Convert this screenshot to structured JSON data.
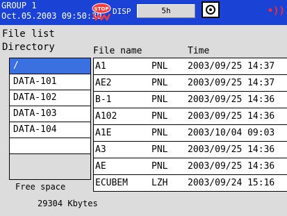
{
  "header": {
    "group": "GROUP 1",
    "datetime": "Oct.05.2003 09:50:30",
    "disp_label": "DISP",
    "disp_value": "5h",
    "stop_icon": "stop-recording-icon",
    "record_icon": "record-target-icon",
    "alarm_icon": "alarm-indicator-icon",
    "colors": {
      "header_bg": "#1a43d6",
      "alarm": "#ff2a2a",
      "selection": "#3b70e0"
    }
  },
  "page": {
    "title": "File list",
    "directory_label": "Directory",
    "filename_header": "File name",
    "time_header": "Time"
  },
  "directories": [
    {
      "name": "/",
      "selected": true
    },
    {
      "name": "DATA-101",
      "selected": false
    },
    {
      "name": "DATA-102",
      "selected": false
    },
    {
      "name": "DATA-103",
      "selected": false
    },
    {
      "name": "DATA-104",
      "selected": false
    },
    {
      "name": "",
      "selected": false
    }
  ],
  "files": [
    {
      "name": "A1",
      "type": "PNL",
      "time": "2003/09/25 14:37"
    },
    {
      "name": "AE2",
      "type": "PNL",
      "time": "2003/09/25 14:37"
    },
    {
      "name": "B-1",
      "type": "PNL",
      "time": "2003/09/25 14:36"
    },
    {
      "name": "A102",
      "type": "PNL",
      "time": "2003/09/25 14:36"
    },
    {
      "name": "A1E",
      "type": "PNL",
      "time": "2003/10/04 09:03"
    },
    {
      "name": "A3",
      "type": "PNL",
      "time": "2003/09/25 14:36"
    },
    {
      "name": "AE",
      "type": "PNL",
      "time": "2003/09/25 14:36"
    },
    {
      "name": "ECUBEM",
      "type": "LZH",
      "time": "2003/09/24 15:16"
    }
  ],
  "free_space": {
    "label": "Free space",
    "value": "29304 Kbytes"
  }
}
